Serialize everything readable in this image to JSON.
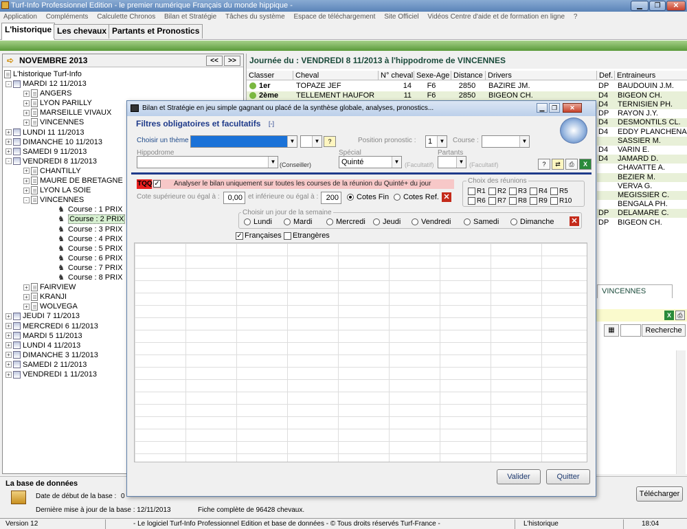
{
  "window": {
    "title": "Turf-Info Professionnel Edition - le premier numérique Français du monde hippique -",
    "controls": [
      "▁",
      "❐",
      "✕"
    ]
  },
  "menu": [
    "Application",
    "Compléments",
    "Calculette Chronos",
    "Bilan et Stratégie",
    "Tâches du système",
    "Espace de téléchargement",
    "Site Officiel",
    "Vidéos Centre d'aide et de formation en ligne",
    "?"
  ],
  "tabs": [
    "L'historique",
    "Les chevaux",
    "Partants et Pronostics"
  ],
  "left": {
    "month": "NOVEMBRE 2013",
    "prev": "<<",
    "next": ">>",
    "root": "L'historique Turf-Info",
    "nodes": [
      {
        "label": "MARDI 12 11/2013",
        "kind": "day",
        "exp": "-"
      },
      {
        "label": "ANGERS",
        "kind": "track",
        "exp": "+"
      },
      {
        "label": "LYON PARILLY",
        "kind": "track",
        "exp": "+"
      },
      {
        "label": "MARSEILLE VIVAUX",
        "kind": "track",
        "exp": "+"
      },
      {
        "label": "VINCENNES",
        "kind": "track",
        "exp": "+"
      },
      {
        "label": "LUNDI 11 11/2013",
        "kind": "day",
        "exp": "+"
      },
      {
        "label": "DIMANCHE 10 11/2013",
        "kind": "day",
        "exp": "+"
      },
      {
        "label": "SAMEDI 9 11/2013",
        "kind": "day",
        "exp": "+"
      },
      {
        "label": "VENDREDI 8 11/2013",
        "kind": "day",
        "exp": "-"
      },
      {
        "label": "CHANTILLY",
        "kind": "track",
        "exp": "+"
      },
      {
        "label": "MAURE DE BRETAGNE",
        "kind": "track",
        "exp": "+"
      },
      {
        "label": "LYON LA SOIE",
        "kind": "track",
        "exp": "+"
      },
      {
        "label": "VINCENNES",
        "kind": "track",
        "exp": "-"
      },
      {
        "label": "Course : 1 PRIX",
        "kind": "race"
      },
      {
        "label": "Course : 2 PRIX",
        "kind": "race",
        "selected": true
      },
      {
        "label": "Course : 3 PRIX",
        "kind": "race"
      },
      {
        "label": "Course : 4 PRIX",
        "kind": "race"
      },
      {
        "label": "Course : 5 PRIX",
        "kind": "race"
      },
      {
        "label": "Course : 6 PRIX",
        "kind": "race"
      },
      {
        "label": "Course : 7 PRIX",
        "kind": "race"
      },
      {
        "label": "Course : 8 PRIX",
        "kind": "race"
      },
      {
        "label": "FAIRVIEW",
        "kind": "track",
        "exp": "+"
      },
      {
        "label": "KRANJI",
        "kind": "track",
        "exp": "+"
      },
      {
        "label": "WOLVEGA",
        "kind": "track",
        "exp": "+"
      },
      {
        "label": "JEUDI 7 11/2013",
        "kind": "day",
        "exp": "+"
      },
      {
        "label": "MERCREDI 6 11/2013",
        "kind": "day",
        "exp": "+"
      },
      {
        "label": "MARDI 5 11/2013",
        "kind": "day",
        "exp": "+"
      },
      {
        "label": "LUNDI 4 11/2013",
        "kind": "day",
        "exp": "+"
      },
      {
        "label": "DIMANCHE 3 11/2013",
        "kind": "day",
        "exp": "+"
      },
      {
        "label": "SAMEDI 2 11/2013",
        "kind": "day",
        "exp": "+"
      },
      {
        "label": "VENDREDI 1 11/2013",
        "kind": "day",
        "exp": "+"
      }
    ]
  },
  "right": {
    "title": "Journée du : VENDREDI 8 11/2013 à l'hippodrome de VINCENNES",
    "columns": [
      "Classer",
      "Cheval",
      "N° cheval",
      "Sexe-Age",
      "Distance",
      "Drivers",
      "Def.",
      "Entraineurs"
    ],
    "rows": [
      {
        "classer": "1er",
        "cheval": "TOPAZE JEF",
        "num": "14",
        "sexe": "F6",
        "dist": "2850",
        "driver": "BAZIRE JM.",
        "def": "DP",
        "trainer": "BAUDOUIN J.M."
      },
      {
        "classer": "2ème",
        "cheval": "TELLEMENT HAUFOR",
        "num": "11",
        "sexe": "F6",
        "dist": "2850",
        "driver": "BIGEON CH.",
        "def": "D4",
        "trainer": "BIGEON CH."
      }
    ],
    "trainers_tail": [
      {
        "def": "D4",
        "trainer": "TERNISIEN PH."
      },
      {
        "def": "DP",
        "trainer": "RAYON J.Y."
      },
      {
        "def": "D4",
        "trainer": "DESMONTILS CL."
      },
      {
        "def": "D4",
        "trainer": "EDDY PLANCHENAU"
      },
      {
        "def": "",
        "trainer": "SASSIER M."
      },
      {
        "def": "D4",
        "trainer": "VARIN E."
      },
      {
        "def": "D4",
        "trainer": "JAMARD D."
      },
      {
        "def": "",
        "trainer": "CHAVATTE A."
      },
      {
        "def": "",
        "trainer": "BEZIER M."
      },
      {
        "def": "",
        "trainer": "VERVA G."
      },
      {
        "def": "",
        "trainer": "MEGISSIER C."
      },
      {
        "def": "",
        "trainer": "BENGALA PH."
      },
      {
        "def": "DP",
        "trainer": "DELAMARE C."
      },
      {
        "def": "DP",
        "trainer": "BIGEON CH."
      }
    ],
    "lower_tab": "VINCENNES",
    "search_button": "Recherche"
  },
  "db": {
    "header": "La base de données",
    "start_label": "Date de début de la base :",
    "start_value": "0",
    "update_label": "Dernière mise à jour de la base : 12/11/2013",
    "count_text": "Fiche complète de 96428 chevaux.",
    "download": "Télécharger"
  },
  "status": {
    "version": "Version 12",
    "copyright": "- Le logiciel Turf-Info Professionnel Edition et base de données - © Tous droits réservés Turf-France -",
    "view": "L'historique",
    "time": "18:04"
  },
  "dialog": {
    "title": "Bilan et Stratégie en jeu simple gagnant ou placé de la synthèse globale, analyses, pronostics...",
    "filters_title": "Filtres obligatoires et facultatifs",
    "filters_toggle": "[-]",
    "theme_label": "Choisir un thème",
    "theme_value": "",
    "position_label": "Position pronostic :",
    "position_value": "1",
    "course_label": "Course :",
    "course_value": "",
    "hippodrome_label": "Hippodrome",
    "hippodrome_value": "",
    "conseiller": "(Conseiller)",
    "special_label": "Spécial",
    "special_value": "Quinté",
    "facultatif": "(Facultatif)",
    "partants_label": "Partants",
    "partants_value": "",
    "tqq_badge": "TQQ",
    "tqq_text": "Analyser le bilan uniquement sur toutes les courses de la réunion du Quinté+ du jour",
    "cote_sup_label": "Cote supérieure ou égal à :",
    "cote_sup_value": "0,00",
    "cote_inf_label": "et inférieure ou égal à :",
    "cote_inf_value": "200",
    "cotes_fin": "Cotes Fin",
    "cotes_ref": "Cotes Ref.",
    "reunions_label": "Choix des réunions",
    "reunions": [
      "R1",
      "R2",
      "R3",
      "R4",
      "R5",
      "R6",
      "R7",
      "R8",
      "R9",
      "R10"
    ],
    "weekday_label": "Choisir un jour de la semaine",
    "weekdays": [
      "Lundi",
      "Mardi",
      "Mercredi",
      "Jeudi",
      "Vendredi",
      "Samedi",
      "Dimanche"
    ],
    "francaises": "Françaises",
    "etrangeres": "Etrangères",
    "validate": "Valider",
    "quit": "Quitter",
    "colors": {
      "accent": "#1e3a8a",
      "tqq": "#e82020",
      "tqq_bg": "#f7c8c8",
      "select": "#1a72d8"
    }
  }
}
